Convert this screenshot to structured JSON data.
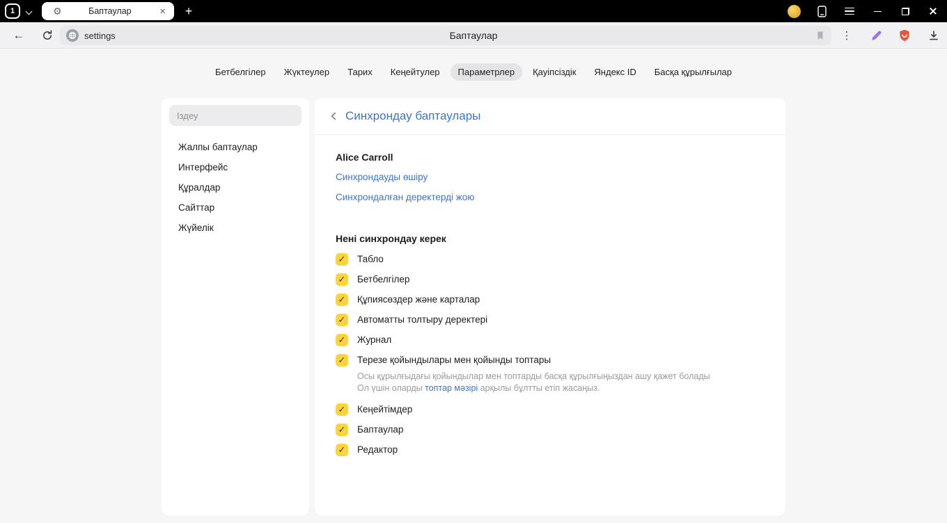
{
  "window": {
    "tab_group_label": "1",
    "tab_title": "Баптаулар"
  },
  "toolbar": {
    "address_text": "settings",
    "page_title": "Баптаулар"
  },
  "icons": {
    "back": "←",
    "gear": "⚙",
    "tab_close": "×",
    "new_tab": "+",
    "menu_dots": "⋮",
    "checkmark": "✓"
  },
  "nav_tabs": [
    {
      "label": "Бетбелгілер",
      "active": false
    },
    {
      "label": "Жүктеулер",
      "active": false
    },
    {
      "label": "Тарих",
      "active": false
    },
    {
      "label": "Кеңейтулер",
      "active": false
    },
    {
      "label": "Параметрлер",
      "active": true
    },
    {
      "label": "Қауіпсіздік",
      "active": false
    },
    {
      "label": "Яндекс ID",
      "active": false
    },
    {
      "label": "Басқа құрылғылар",
      "active": false
    }
  ],
  "sidebar": {
    "search_placeholder": "Іздеу",
    "items": [
      "Жалпы баптаулар",
      "Интерфейс",
      "Құралдар",
      "Сайттар",
      "Жүйелік"
    ]
  },
  "main": {
    "title": "Синхрондау баптаулары",
    "account_name": "Alice Carroll",
    "links": [
      "Синхрондауды өшіру",
      "Синхрондалған деректерді жою"
    ],
    "section_heading": "Нені синхрондау керек",
    "checkboxes": [
      {
        "label": "Табло",
        "checked": true
      },
      {
        "label": "Бетбелгілер",
        "checked": true
      },
      {
        "label": "Құпиясөздер және карталар",
        "checked": true
      },
      {
        "label": "Автоматты толтыру деректері",
        "checked": true
      },
      {
        "label": "Журнал",
        "checked": true
      },
      {
        "label": "Терезе қойындылары мен қойынды топтары",
        "checked": true,
        "description_line1": "Осы құрылғыдағы қойындылар мен топтарды басқа құрылғыңыздан ашу қажет болады",
        "description_line2_prefix": "Ол үшін оларды ",
        "description_link": "топтар мәзірі",
        "description_line2_suffix": " арқылы бұлтты етіп жасаңыз."
      },
      {
        "label": "Кеңейтімдер",
        "checked": true
      },
      {
        "label": "Баптаулар",
        "checked": true
      },
      {
        "label": "Редактор",
        "checked": true
      }
    ]
  },
  "colors": {
    "titlebar_bg": "#000000",
    "accent_blue": "#3b75c9",
    "checkbox_yellow": "#ffd43b",
    "protect_shield_red": "#e4573d",
    "pen_purple": "#9a6ff0",
    "active_pill_gray": "#e4e4e7"
  }
}
